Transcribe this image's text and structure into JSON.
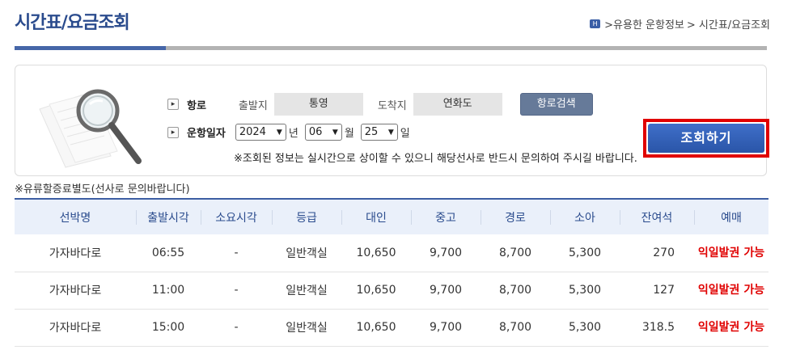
{
  "page": {
    "title": "시간표/요금조회",
    "breadcrumb": [
      ">유용한 운항정보",
      "> 시간표/요금조회"
    ]
  },
  "search": {
    "route_label": "항로",
    "depart_label": "출발지",
    "depart_value": "통영",
    "arrive_label": "도착지",
    "arrive_value": "연화도",
    "route_search_button": "항로검색",
    "date_label": "운항일자",
    "year": "2024",
    "year_unit": "년",
    "month": "06",
    "month_unit": "월",
    "day": "25",
    "day_unit": "일",
    "query_button": "조회하기",
    "notice": "※조회된 정보는 실시간으로 상이할 수 있으니 해당선사로 반드시 문의하여 주시길 바랍니다."
  },
  "fuel_note": "※유류할증료별도(선사로 문의바랍니다)",
  "table": {
    "headers": [
      "선박명",
      "출발시각",
      "소요시각",
      "등급",
      "대인",
      "중고",
      "경로",
      "소아",
      "잔여석",
      "예매"
    ],
    "rows": [
      [
        "가자바다로",
        "06:55",
        "-",
        "일반객실",
        "10,650",
        "9,700",
        "8,700",
        "5,300",
        "270",
        "익일발권 가능"
      ],
      [
        "가자바다로",
        "11:00",
        "-",
        "일반객실",
        "10,650",
        "9,700",
        "8,700",
        "5,300",
        "127",
        "익일발권 가능"
      ],
      [
        "가자바다로",
        "15:00",
        "-",
        "일반객실",
        "10,650",
        "9,700",
        "8,700",
        "5,300",
        "318.5",
        "익일발권 가능"
      ]
    ]
  },
  "colors": {
    "title": "#2a4b8d",
    "accent": "#4666a8",
    "query_button": "#2f5db8",
    "highlight_frame": "#e00000",
    "reservation_text": "#e00000"
  }
}
